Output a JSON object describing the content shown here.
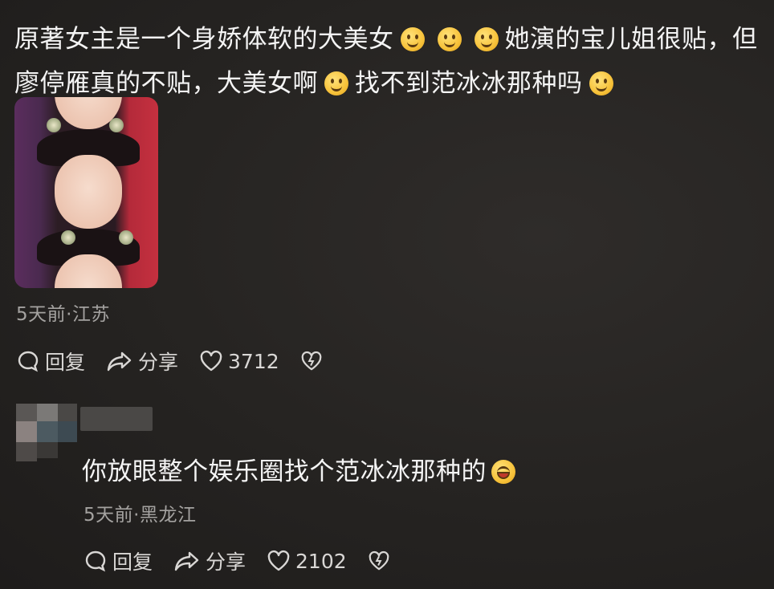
{
  "comment": {
    "text_parts": [
      "原著女主是一个身娇体软的大美女",
      "她演的宝儿姐很贴，但廖停雁真的不贴，大美女啊",
      "找不到范冰冰那种吗"
    ],
    "meta": "5天前·江苏",
    "reply_label": "回复",
    "share_label": "分享",
    "like_count": "3712"
  },
  "reply": {
    "text": "你放眼整个娱乐圈找个范冰冰那种的",
    "meta": "5天前·黑龙江",
    "reply_label": "回复",
    "share_label": "分享",
    "like_count": "2102"
  },
  "icons": {
    "emoji": "smile-emoji-icon",
    "laugh": "laughing-tears-emoji-icon",
    "reply": "speech-bubble-icon",
    "share": "share-arrow-icon",
    "like": "heart-icon",
    "dislike": "broken-heart-icon"
  },
  "colors": {
    "background": "#252321",
    "text": "#f4f4f4",
    "meta": "#a4a2a0"
  }
}
